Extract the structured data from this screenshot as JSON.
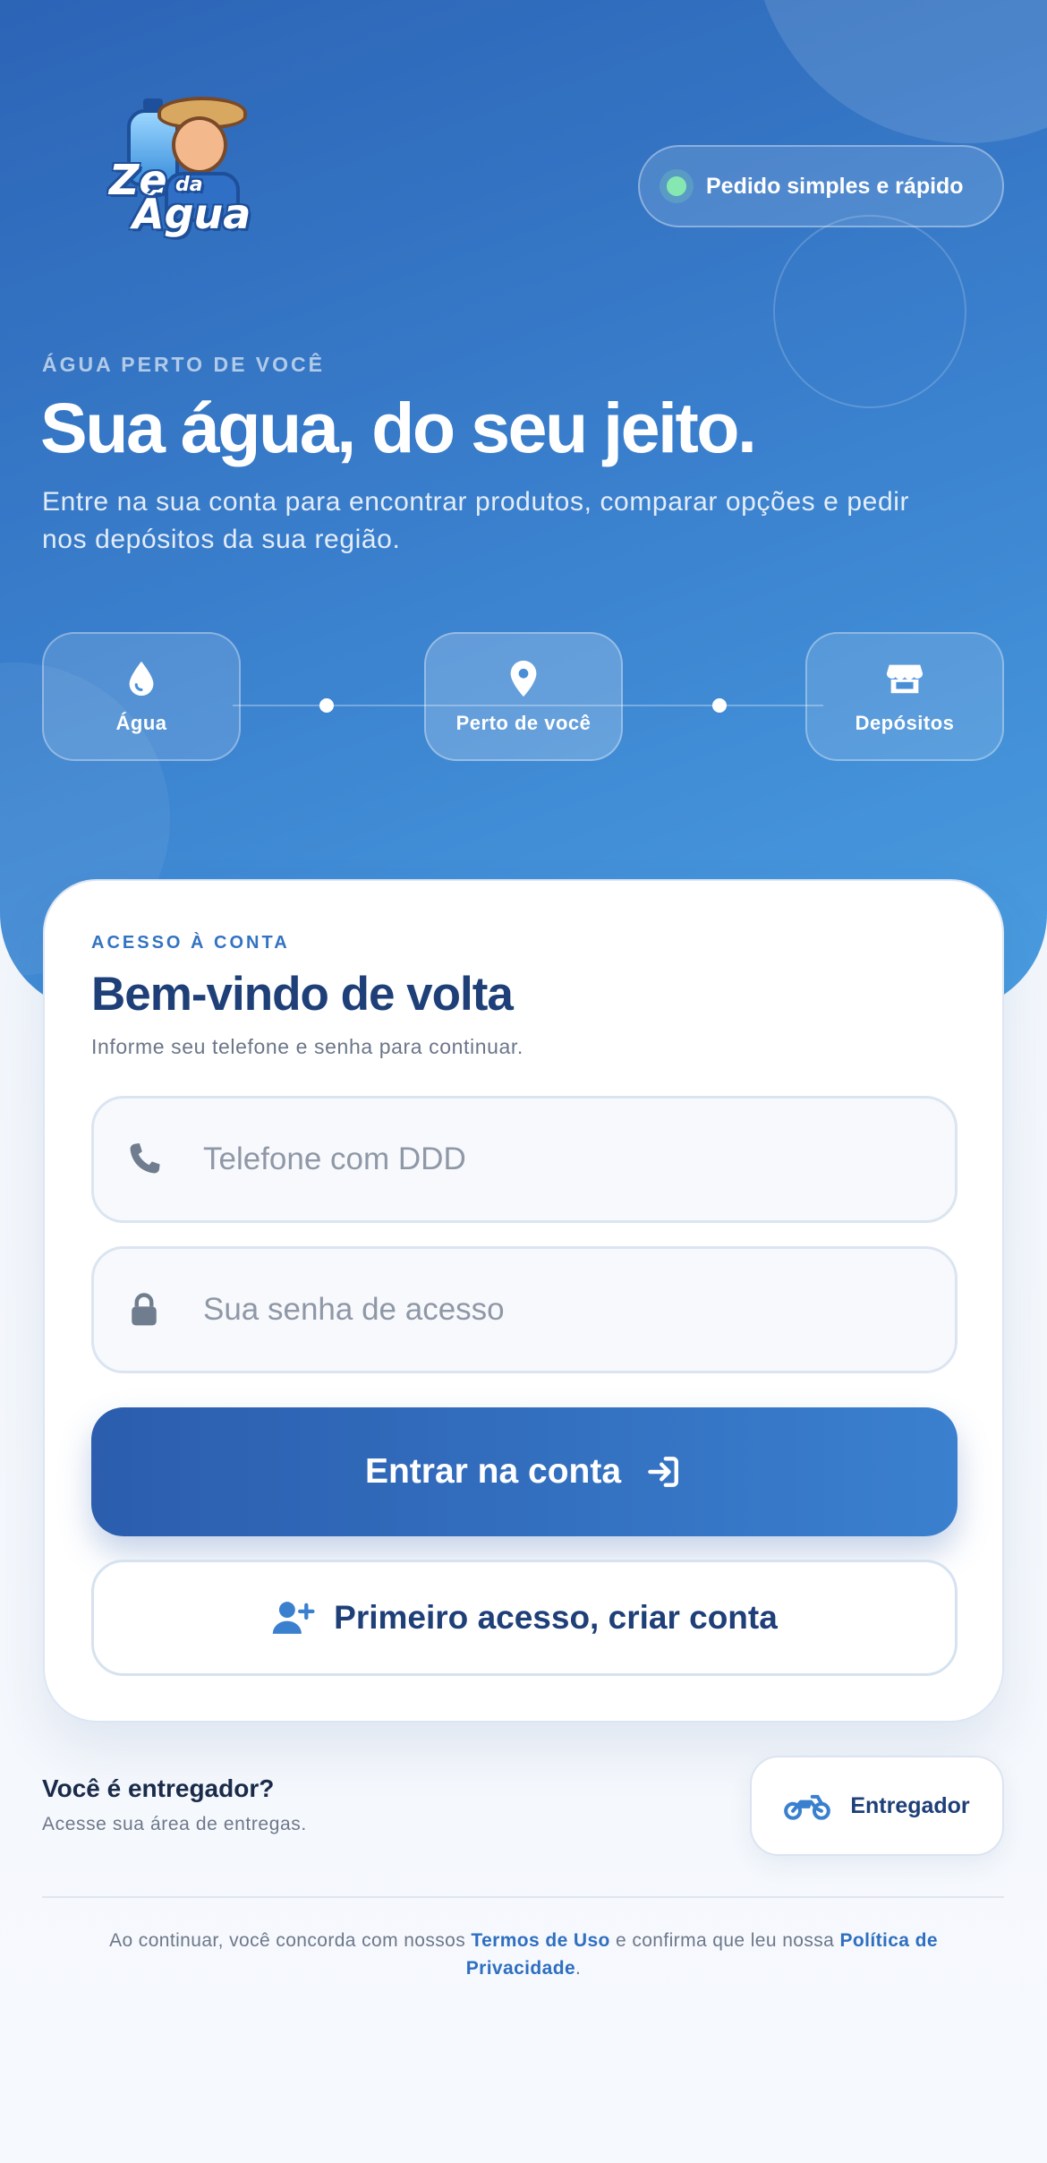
{
  "hero": {
    "logo_text": {
      "line1": "Ze",
      "small": "da",
      "line2": "Água"
    },
    "pill": "Pedido simples e rápido",
    "eyebrow": "ÁGUA PERTO DE VOCÊ",
    "title": "Sua água, do seu jeito.",
    "subtitle": "Entre na sua conta para encontrar produtos, comparar opções e pedir nos depósitos da sua região.",
    "features": [
      {
        "label": "Água",
        "icon": "water-drop-icon"
      },
      {
        "label": "Perto de você",
        "icon": "map-pin-icon"
      },
      {
        "label": "Depósitos",
        "icon": "store-icon"
      }
    ]
  },
  "login": {
    "eyebrow": "ACESSO À CONTA",
    "title": "Bem-vindo de volta",
    "subtitle": "Informe seu telefone e senha para continuar.",
    "phone": {
      "value": "",
      "placeholder": "Telefone com DDD",
      "icon": "phone-icon"
    },
    "password": {
      "value": "",
      "placeholder": "Sua senha de acesso",
      "icon": "lock-icon"
    },
    "submit_label": "Entrar na conta",
    "signup_label": "Primeiro acesso, criar conta"
  },
  "courier": {
    "title": "Você é entregador?",
    "subtitle": "Acesse sua área de entregas.",
    "button_label": "Entregador",
    "icon": "motorcycle-icon"
  },
  "legal": {
    "prefix": "Ao continuar, você concorda com nossos ",
    "terms": "Termos de Uso",
    "middle": " e confirma que leu nossa ",
    "privacy": "Política de Privacidade",
    "suffix": "."
  },
  "colors": {
    "primary": "#2c5dae",
    "accent": "#3a80cf",
    "title_dark": "#1e3f78",
    "online_dot": "#86e8b0"
  }
}
